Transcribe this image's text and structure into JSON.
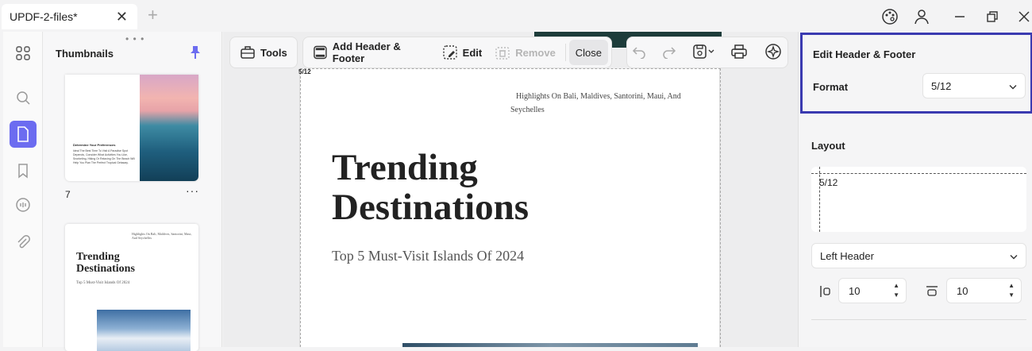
{
  "titlebar": {
    "tab_label": "UPDF-2-files*",
    "tab_close": "✕",
    "new_tab": "+"
  },
  "thumbnails": {
    "title": "Thumbnails",
    "page7": {
      "number": "7",
      "more": "···",
      "heading": "Determine Your Preferences",
      "body": "Ideal The Best Time To Visit A Paradise Spot Depends, Consider What Activities You Like, Snorkeling, Hiking Or Relaxing On The Beach Will Help You Plan The Perfect Tropical Getaway."
    },
    "page8": {
      "header": "Highlights On Bali, Maldives, Santorini, Maui, And Seychelles",
      "title": "Trending Destinations",
      "subtitle": "Top 5 Must-Visit Islands Of 2024"
    }
  },
  "toolbar": {
    "tools_label": "Tools",
    "add_header_footer_label": "Add Header & Footer",
    "edit_label": "Edit",
    "remove_label": "Remove",
    "close_label": "Close"
  },
  "document": {
    "page_marker": "5/12",
    "header_text_line1": "Highlights On Bali, Maldives, Santorini, Maui, And",
    "header_text_line2": "Seychelles",
    "title_line1": "Trending",
    "title_line2": "Destinations",
    "subtitle": "Top 5 Must-Visit Islands Of 2024"
  },
  "panel": {
    "section_title": "Edit Header & Footer",
    "format_label": "Format",
    "format_value": "5/12",
    "layout_label": "Layout",
    "preview_text": "5/12",
    "position_value": "Left Header",
    "left_margin_value": "10",
    "top_margin_value": "10"
  },
  "colors": {
    "accent": "#6c6cf0",
    "highlight_border": "#3a3ab0",
    "pin": "#6c6cf0"
  }
}
